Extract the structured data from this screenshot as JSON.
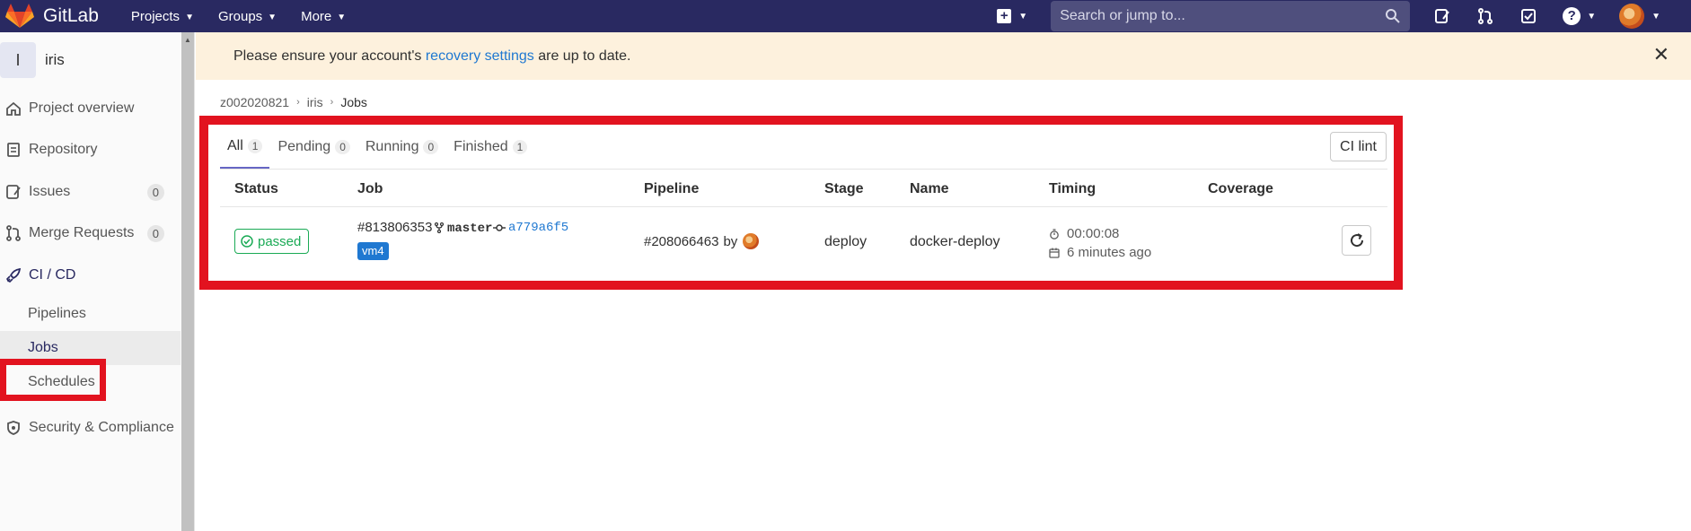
{
  "navbar": {
    "brand": "GitLab",
    "menu": [
      {
        "label": "Projects"
      },
      {
        "label": "Groups"
      },
      {
        "label": "More"
      }
    ],
    "search_placeholder": "Search or jump to...",
    "icons": [
      "plus-square-icon",
      "search-icon",
      "todo-issues-icon",
      "merge-request-icon",
      "todo-check-icon",
      "help-icon",
      "user-avatar"
    ]
  },
  "sidebar": {
    "project_initial": "I",
    "project_name": "iris",
    "items": [
      {
        "label": "Project overview",
        "icon": "home-icon"
      },
      {
        "label": "Repository",
        "icon": "doc-icon"
      },
      {
        "label": "Issues",
        "icon": "issues-icon",
        "count": "0"
      },
      {
        "label": "Merge Requests",
        "icon": "merge-request-icon",
        "count": "0"
      },
      {
        "label": "CI / CD",
        "icon": "rocket-icon"
      },
      {
        "label": "Security & Compliance",
        "icon": "shield-icon"
      }
    ],
    "subitems": [
      {
        "label": "Pipelines"
      },
      {
        "label": "Jobs"
      },
      {
        "label": "Schedules"
      }
    ]
  },
  "alert": {
    "prefix": "Please ensure your account's ",
    "link": "recovery settings",
    "suffix": " are up to date."
  },
  "breadcrumb": {
    "group": "z002020821",
    "project": "iris",
    "current": "Jobs"
  },
  "tabs": [
    {
      "label": "All",
      "count": "1"
    },
    {
      "label": "Pending",
      "count": "0"
    },
    {
      "label": "Running",
      "count": "0"
    },
    {
      "label": "Finished",
      "count": "1"
    }
  ],
  "ci_lint_label": "CI lint",
  "table": {
    "headers": {
      "status": "Status",
      "job": "Job",
      "pipeline": "Pipeline",
      "stage": "Stage",
      "name": "Name",
      "timing": "Timing",
      "coverage": "Coverage"
    },
    "row": {
      "status": "passed",
      "job_id": "#813806353",
      "branch": "master",
      "commit": "a779a6f5",
      "tag": "vm4",
      "pipeline_id": "#208066463",
      "pipeline_by": "by",
      "stage": "deploy",
      "name": "docker-deploy",
      "duration": "00:00:08",
      "finished": "6 minutes ago"
    }
  },
  "colors": {
    "navbar": "#292961",
    "alert_bg": "#fdf1dd",
    "link": "#1f78d1",
    "success": "#1aaa55",
    "highlight_box": "#e2131f"
  }
}
